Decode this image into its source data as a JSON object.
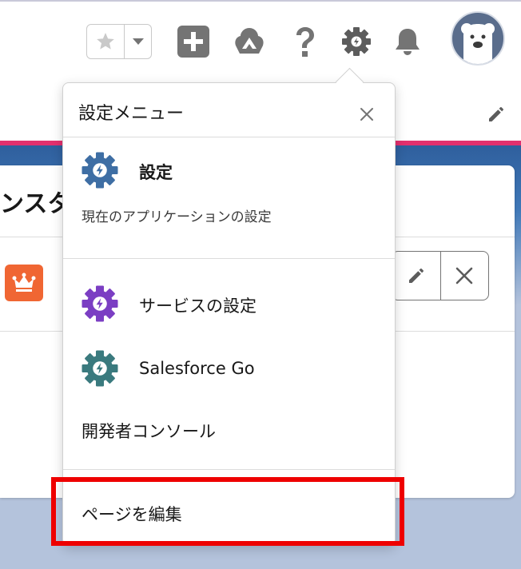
{
  "header": {
    "favorites_icon": "star-icon",
    "favorites_menu_icon": "chevron-down-icon",
    "global_actions_icon": "plus-icon",
    "trailhead_icon": "trailhead-icon",
    "help_icon": "question-icon",
    "setup_icon": "gear-icon",
    "notifications_icon": "bell-icon",
    "avatar_icon": "bear-avatar-icon"
  },
  "card": {
    "title": "ンスタ",
    "badge_icon": "crown-icon"
  },
  "setup_menu": {
    "title": "設定メニュー",
    "items": [
      {
        "label": "設定",
        "description": "現在のアプリケーションの設定",
        "icon": "setup-gear-icon"
      },
      {
        "label": "サービスの設定",
        "icon": "service-setup-gear-icon"
      },
      {
        "label": "Salesforce Go",
        "icon": "salesforce-go-gear-icon"
      },
      {
        "label": "開発者コンソール"
      },
      {
        "label": "ページを編集"
      }
    ]
  },
  "colors": {
    "brand_band": "#e3306e",
    "setup_gear": "#3e6ea4",
    "service_gear": "#7b3ec3",
    "go_gear": "#3a7a7e",
    "highlight": "#ee0000",
    "crown_badge": "#f06633"
  }
}
